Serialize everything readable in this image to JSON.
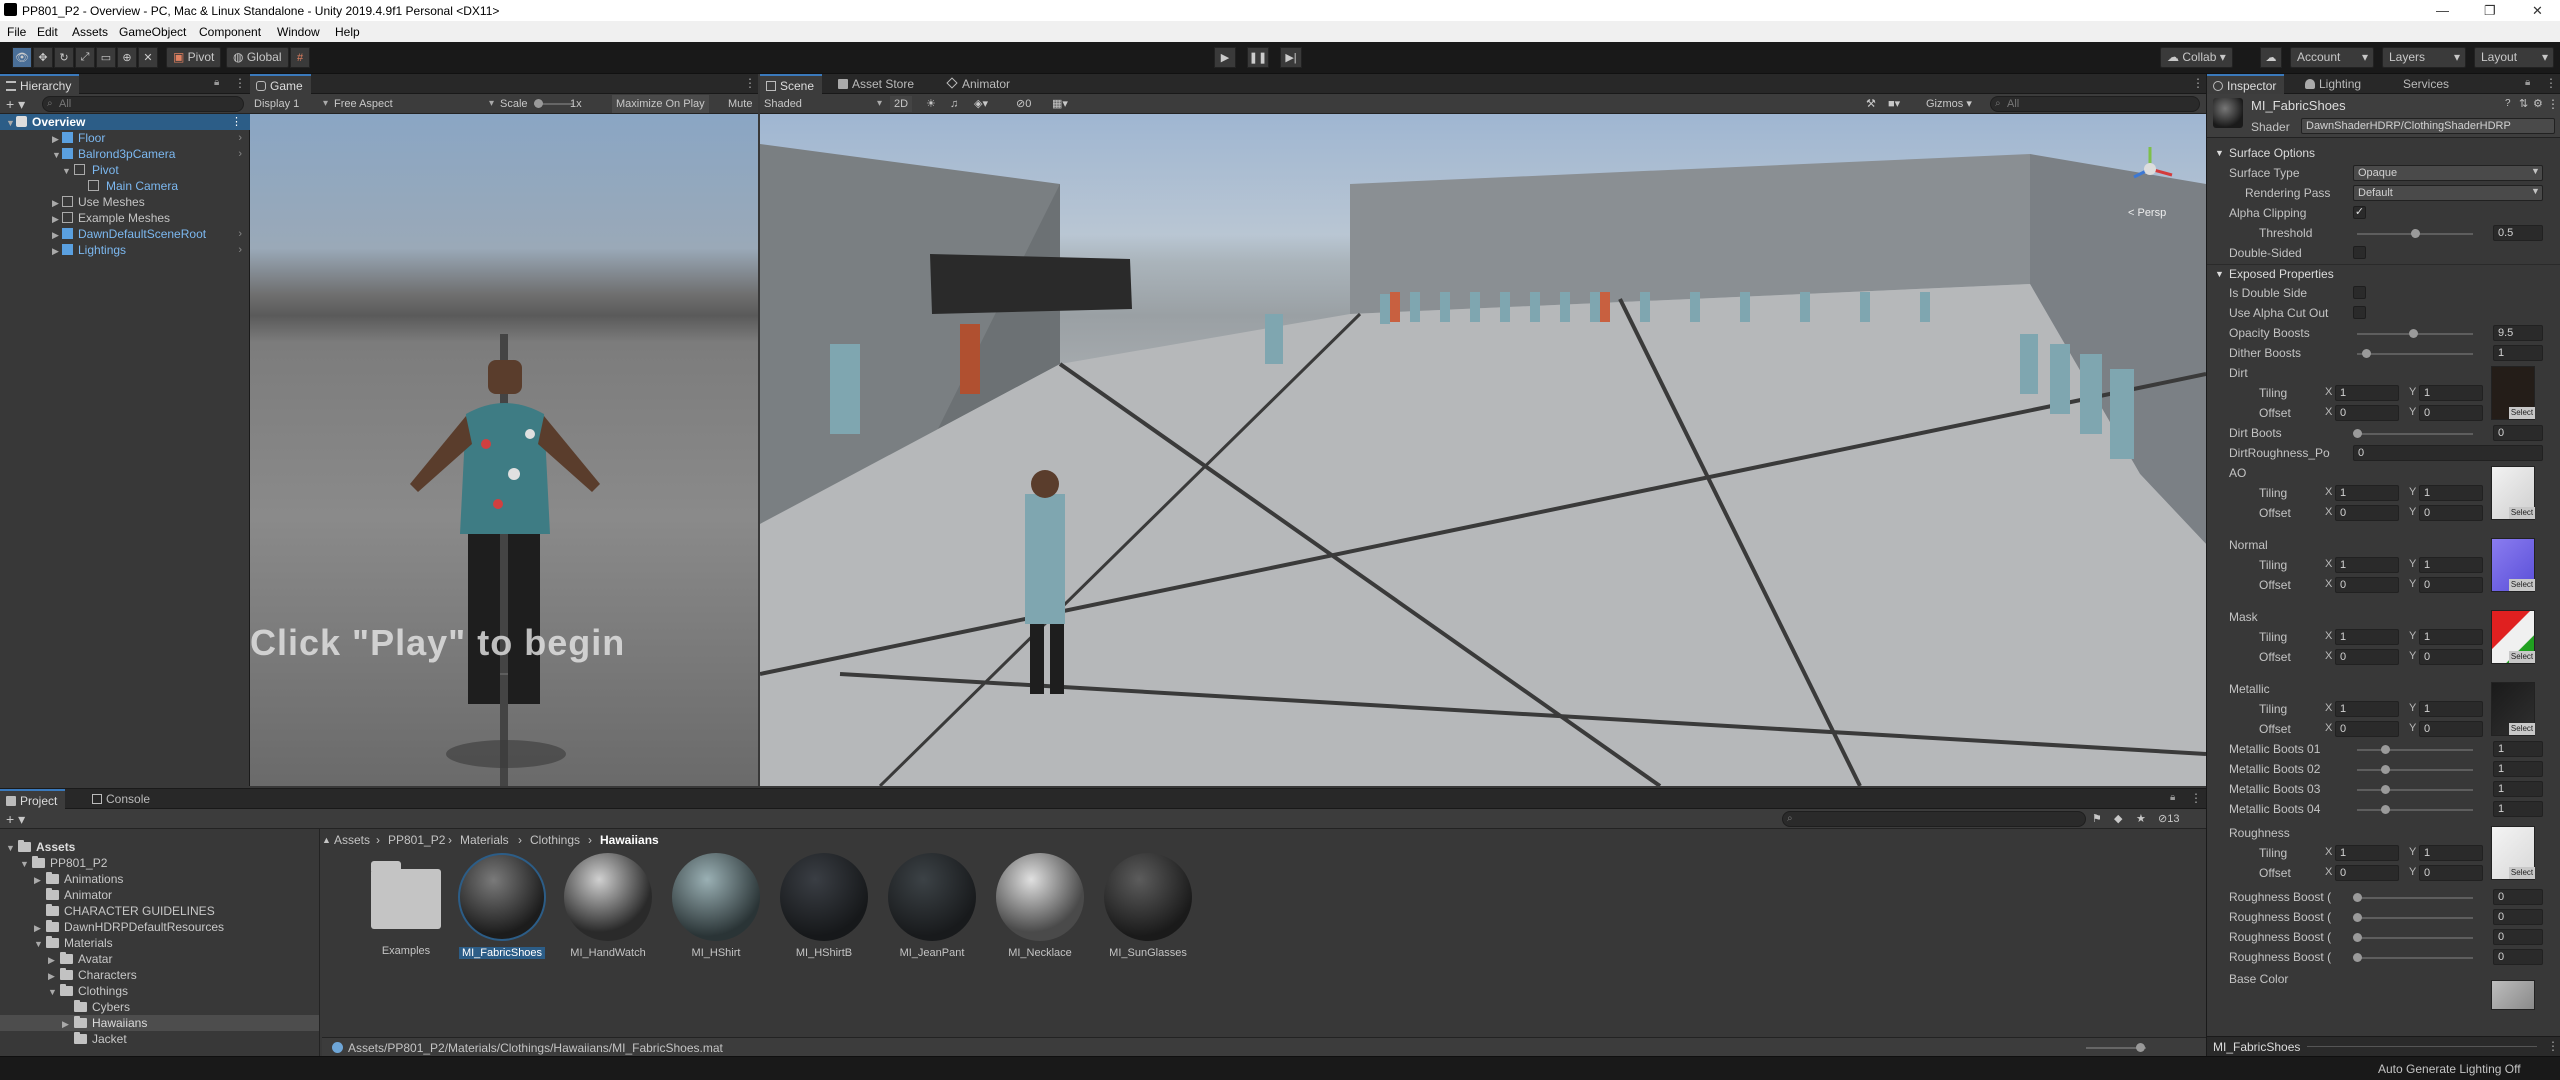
{
  "window": {
    "title": "PP801_P2 - Overview - PC, Mac & Linux Standalone - Unity 2019.4.9f1 Personal <DX11>"
  },
  "menu": [
    "File",
    "Edit",
    "Assets",
    "GameObject",
    "Component",
    "Window",
    "Help"
  ],
  "toolbar": {
    "pivot_label": "Pivot",
    "global_label": "Global",
    "collab_label": "Collab",
    "account_label": "Account",
    "layers_label": "Layers",
    "layout_label": "Layout"
  },
  "hierarchy": {
    "tab_label": "Hierarchy",
    "search_placeholder": "All",
    "items": [
      {
        "label": "Overview"
      },
      {
        "label": "Floor"
      },
      {
        "label": "Balrond3pCamera"
      },
      {
        "label": "Pivot"
      },
      {
        "label": "Main Camera"
      },
      {
        "label": "Use Meshes"
      },
      {
        "label": "Example Meshes"
      },
      {
        "label": "DawnDefaultSceneRoot"
      },
      {
        "label": "Lightings"
      }
    ]
  },
  "game": {
    "tab_label": "Game",
    "display": "Display 1",
    "aspect": "Free Aspect",
    "scale_label": "Scale",
    "scale_value": "1x",
    "maximize_label": "Maximize On Play",
    "mute_label": "Mute",
    "overlay_text": "Click \"Play\" to begin"
  },
  "scene": {
    "tabs": [
      "Scene",
      "Asset Store",
      "Animator"
    ],
    "shading": "Shaded",
    "mode_2d": "2D",
    "fx_count": "0",
    "gizmos_label": "Gizmos",
    "search_placeholder": "All",
    "persp_label": "< Persp"
  },
  "inspector": {
    "tabs": [
      "Inspector",
      "Lighting",
      "Services"
    ],
    "material_name": "MI_FabricShoes",
    "shader_label": "Shader",
    "shader_value": "DawnShaderHDRP/ClothingShaderHDRP",
    "surface_options": {
      "header": "Surface Options",
      "surface_type_label": "Surface Type",
      "surface_type_value": "Opaque",
      "rendering_pass_label": "Rendering Pass",
      "rendering_pass_value": "Default",
      "alpha_clipping_label": "Alpha Clipping",
      "alpha_clipping_checked": true,
      "threshold_label": "Threshold",
      "threshold_value": "0.5",
      "threshold_fraction": 0.5,
      "double_sided_label": "Double-Sided",
      "double_sided_checked": false
    },
    "exposed": {
      "header": "Exposed Properties",
      "is_double_side_label": "Is Double Side",
      "use_alpha_cutout_label": "Use Alpha Cut Out",
      "opacity_boosts_label": "Opacity Boosts",
      "opacity_boosts_value": "9.5",
      "dither_boosts_label": "Dither Boosts",
      "dither_boosts_value": "1",
      "dirt_label": "Dirt",
      "dirt_boots_label": "Dirt Boots",
      "dirt_boots_value": "0",
      "dirt_roughness_label": "DirtRoughness_Po",
      "dirt_roughness_value": "0",
      "ao_label": "AO",
      "normal_label": "Normal",
      "mask_label": "Mask",
      "metallic_label": "Metallic",
      "metallic_boots": [
        {
          "label": "Metallic Boots 01",
          "value": "1"
        },
        {
          "label": "Metallic Boots 02",
          "value": "1"
        },
        {
          "label": "Metallic Boots 03",
          "value": "1"
        },
        {
          "label": "Metallic Boots 04",
          "value": "1"
        }
      ],
      "roughness_label": "Roughness",
      "roughness_boosts": [
        {
          "label": "Roughness Boost (",
          "value": "0"
        },
        {
          "label": "Roughness Boost (",
          "value": "0"
        },
        {
          "label": "Roughness Boost (",
          "value": "0"
        },
        {
          "label": "Roughness Boost (",
          "value": "0"
        }
      ],
      "base_color_label": "Base Color",
      "tiling_label": "Tiling",
      "offset_label": "Offset",
      "x_label": "X",
      "y_label": "Y",
      "tiling_x": "1",
      "tiling_y": "1",
      "offset_x": "0",
      "offset_y": "0",
      "select_label": "Select"
    },
    "footer_name": "MI_FabricShoes"
  },
  "project": {
    "tabs": [
      "Project",
      "Console"
    ],
    "tree": [
      {
        "label": "Assets"
      },
      {
        "label": "PP801_P2"
      },
      {
        "label": "Animations"
      },
      {
        "label": "Animator"
      },
      {
        "label": "CHARACTER GUIDELINES"
      },
      {
        "label": "DawnHDRPDefaultResources"
      },
      {
        "label": "Materials"
      },
      {
        "label": "Avatar"
      },
      {
        "label": "Characters"
      },
      {
        "label": "Clothings"
      },
      {
        "label": "Cybers"
      },
      {
        "label": "Hawaiians"
      },
      {
        "label": "Jacket"
      }
    ],
    "breadcrumb": [
      "Assets",
      "PP801_P2",
      "Materials",
      "Clothings",
      "Hawaiians"
    ],
    "assets": [
      {
        "label": "Examples"
      },
      {
        "label": "MI_FabricShoes"
      },
      {
        "label": "MI_HandWatch"
      },
      {
        "label": "MI_HShirt"
      },
      {
        "label": "MI_HShirtB"
      },
      {
        "label": "MI_JeanPant"
      },
      {
        "label": "MI_Necklace"
      },
      {
        "label": "MI_SunGlasses"
      }
    ],
    "path": "Assets/PP801_P2/Materials/Clothings/Hawaiians/MI_FabricShoes.mat",
    "count_badge": "13"
  },
  "statusbar": {
    "text": "Auto Generate Lighting Off"
  }
}
